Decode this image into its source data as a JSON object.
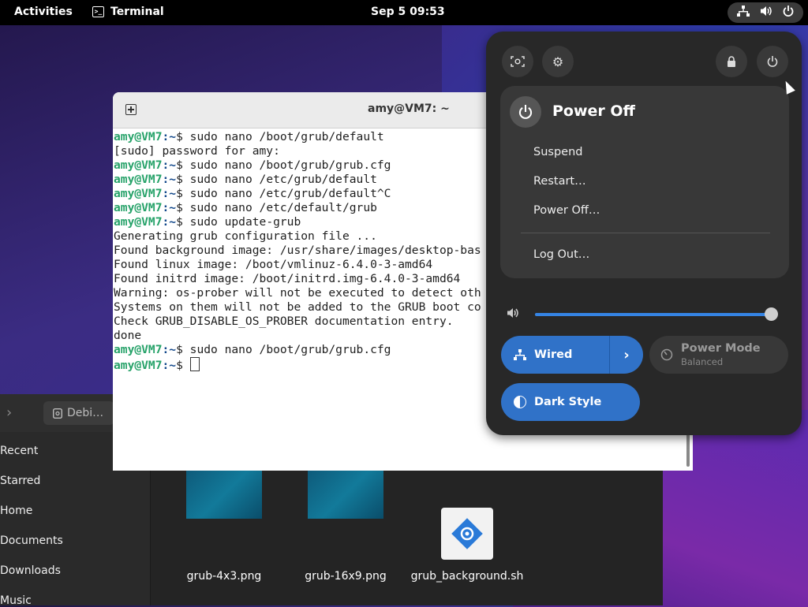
{
  "topbar": {
    "activities": "Activities",
    "app_name": "Terminal",
    "clock": "Sep 5  09:53",
    "status_icons": [
      "network-icon",
      "volume-icon",
      "power-icon"
    ]
  },
  "terminal": {
    "title": "amy@VM7: ~",
    "prompt_user": "amy@VM7",
    "prompt_path": ":~",
    "lines": [
      {
        "prompt": true,
        "cmd": "$ sudo nano /boot/grub/default"
      },
      {
        "prompt": false,
        "text": "[sudo] password for amy:"
      },
      {
        "prompt": true,
        "cmd": "$ sudo nano /boot/grub/grub.cfg"
      },
      {
        "prompt": true,
        "cmd": "$ sudo nano /etc/grub/default"
      },
      {
        "prompt": true,
        "cmd": "$ sudo nano /etc/grub/default^C"
      },
      {
        "prompt": true,
        "cmd": "$ sudo nano /etc/default/grub"
      },
      {
        "prompt": true,
        "cmd": "$ sudo update-grub"
      },
      {
        "prompt": false,
        "text": "Generating grub configuration file ..."
      },
      {
        "prompt": false,
        "text": "Found background image: /usr/share/images/desktop-bas"
      },
      {
        "prompt": false,
        "text": "Found linux image: /boot/vmlinuz-6.4.0-3-amd64"
      },
      {
        "prompt": false,
        "text": "Found initrd image: /boot/initrd.img-6.4.0-3-amd64"
      },
      {
        "prompt": false,
        "text": "Warning: os-prober will not be executed to detect oth"
      },
      {
        "prompt": false,
        "text": "Systems on them will not be added to the GRUB boot co"
      },
      {
        "prompt": false,
        "text": "Check GRUB_DISABLE_OS_PROBER documentation entry."
      },
      {
        "prompt": false,
        "text": "done"
      },
      {
        "prompt": true,
        "cmd": "$ sudo nano /boot/grub/grub.cfg"
      },
      {
        "prompt": true,
        "cmd": "$ ",
        "cursor": true
      }
    ]
  },
  "files": {
    "breadcrumb": "Debi…",
    "sidebar": [
      "Recent",
      "Starred",
      "Home",
      "Documents",
      "Downloads",
      "Music"
    ],
    "items": [
      "grub-4x3.png",
      "grub-16x9.png",
      "grub_background.sh"
    ]
  },
  "quick_settings": {
    "power_menu": {
      "title": "Power Off",
      "items": [
        "Suspend",
        "Restart…",
        "Power Off…"
      ],
      "logout": "Log Out…"
    },
    "volume_level": 0.98,
    "wired": "Wired",
    "power_mode": {
      "title": "Power Mode",
      "subtitle": "Balanced"
    },
    "dark_style": "Dark Style"
  }
}
